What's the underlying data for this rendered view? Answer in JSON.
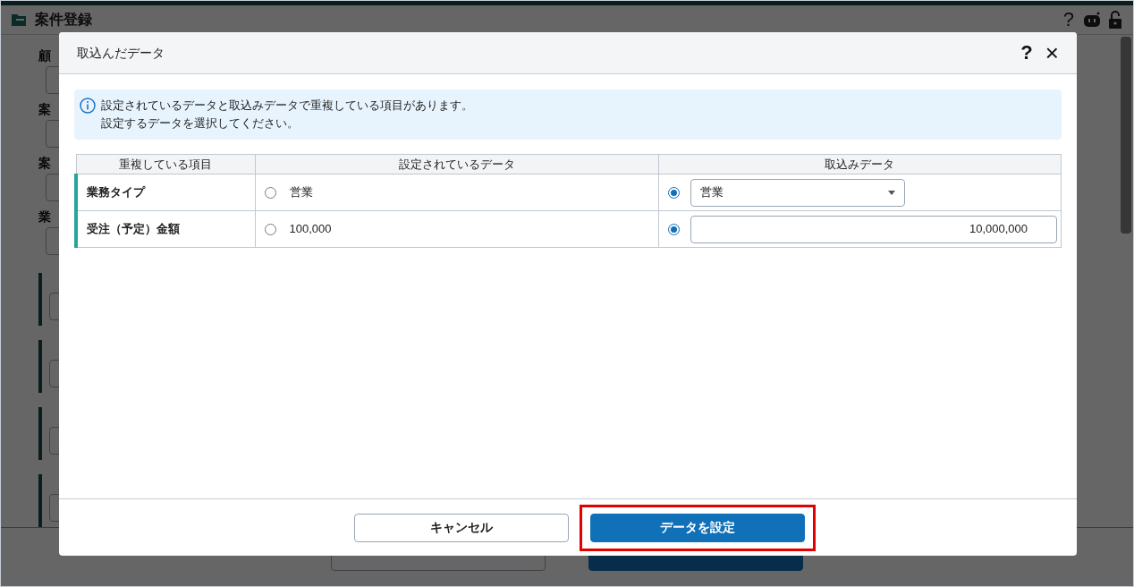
{
  "page": {
    "title": "案件登録",
    "help": "?",
    "fields": [
      {
        "label": "顧"
      },
      {
        "label": "案"
      },
      {
        "label": "案"
      },
      {
        "label": "業"
      }
    ],
    "buttons": [
      {
        "kind": "secondary"
      },
      {
        "kind": "primary"
      }
    ]
  },
  "dialog": {
    "title": "取込んだデータ",
    "help": "?",
    "close": "×",
    "message_lines": [
      "設定されているデータと取込みデータで重複している項目があります。",
      "設定するデータを選択してください。"
    ],
    "table": {
      "columns": [
        "重複している項目",
        "設定されているデータ",
        "取込みデータ"
      ],
      "rows": [
        {
          "item": "業務タイプ",
          "current": {
            "value": "営業",
            "selected": false
          },
          "imported": {
            "value": "営業",
            "selected": true,
            "kind": "select"
          }
        },
        {
          "item": "受注（予定）金額",
          "current": {
            "value": "100,000",
            "selected": false
          },
          "imported": {
            "value": "10,000,000",
            "selected": true,
            "kind": "input"
          }
        }
      ]
    },
    "buttons": [
      {
        "label": "キャンセル",
        "kind": "secondary",
        "highlighted": false
      },
      {
        "label": "データを設定",
        "kind": "primary",
        "highlighted": true
      }
    ]
  }
}
